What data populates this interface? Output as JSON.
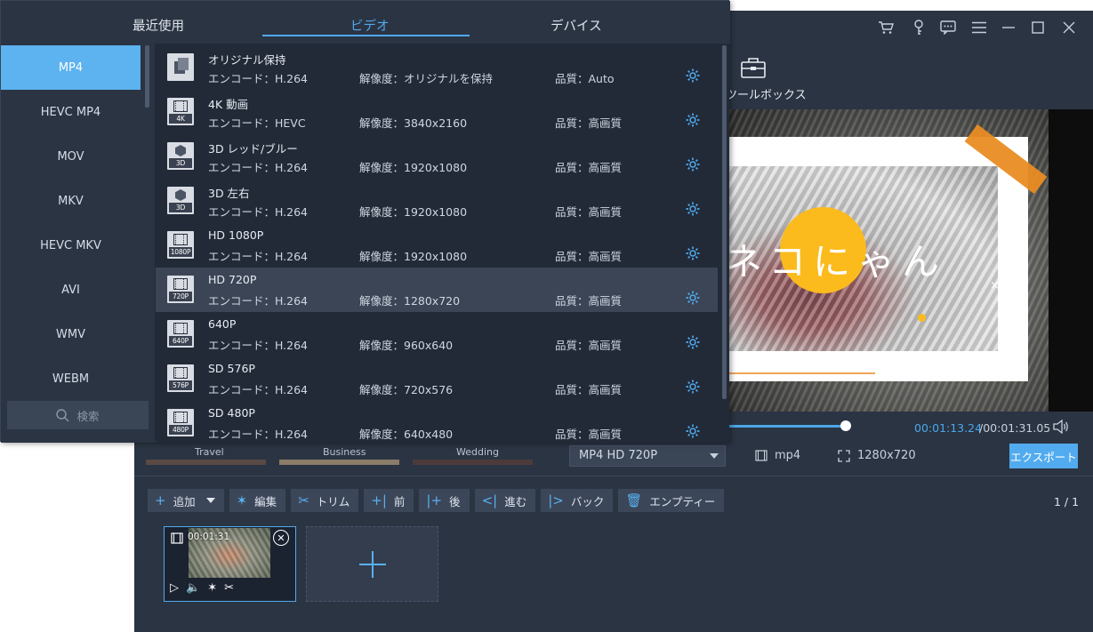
{
  "window": {
    "icons": [
      "cart-icon",
      "key-icon",
      "chat-icon",
      "menu-icon",
      "minimize-icon",
      "maximize-icon",
      "close-icon"
    ]
  },
  "toolbox": {
    "label": "ツールボックス"
  },
  "preview": {
    "title_text": "ネコにゃん"
  },
  "playback": {
    "current_time": "00:01:13.24",
    "total_time": "/00:01:31.05",
    "progress": 0.74
  },
  "themes": {
    "labels": [
      "Travel",
      "Business",
      "Wedding"
    ]
  },
  "output": {
    "format": "MP4 HD 720P",
    "extension": "mp4",
    "resolution": "1280x720",
    "export_label": "エクスポート"
  },
  "actions": [
    {
      "id": "add",
      "icon": "+",
      "label": "追加",
      "dropdown": true
    },
    {
      "id": "edit",
      "icon": "✶",
      "label": "編集"
    },
    {
      "id": "trim",
      "icon": "✂",
      "label": "トリム"
    },
    {
      "id": "before",
      "icon": "+|",
      "label": "前"
    },
    {
      "id": "after",
      "icon": "|+",
      "label": "後"
    },
    {
      "id": "forward",
      "icon": "<|",
      "label": "進む"
    },
    {
      "id": "back",
      "icon": "|>",
      "label": "バック"
    },
    {
      "id": "empty",
      "icon": "🗑",
      "label": "エンプティー"
    }
  ],
  "page_count": "1 / 1",
  "clip": {
    "duration": "00:01:31"
  },
  "format_panel": {
    "tabs": [
      {
        "label": "最近使用",
        "active": false
      },
      {
        "label": "ビデオ",
        "active": true
      },
      {
        "label": "デバイス",
        "active": false
      }
    ],
    "categories": [
      {
        "label": "MP4",
        "active": true
      },
      {
        "label": "HEVC MP4",
        "active": false
      },
      {
        "label": "MOV",
        "active": false
      },
      {
        "label": "MKV",
        "active": false
      },
      {
        "label": "HEVC MKV",
        "active": false
      },
      {
        "label": "AVI",
        "active": false
      },
      {
        "label": "WMV",
        "active": false
      },
      {
        "label": "WEBM",
        "active": false
      }
    ],
    "search_placeholder": "検索",
    "presets": [
      {
        "name": "オリジナル保持",
        "encode": "エンコード：H.264",
        "resolution": "解像度：オリジナルを保持",
        "quality": "品質：Auto",
        "icon": "original",
        "tag": "",
        "active": false
      },
      {
        "name": "4K 動画",
        "encode": "エンコード：HEVC",
        "resolution": "解像度：3840x2160",
        "quality": "品質：高画質",
        "icon": "film",
        "tag": "4K",
        "active": false
      },
      {
        "name": "3D レッド/ブルー",
        "encode": "エンコード：H.264",
        "resolution": "解像度：1920x1080",
        "quality": "品質：高画質",
        "icon": "cube",
        "tag": "3D",
        "active": false
      },
      {
        "name": "3D 左右",
        "encode": "エンコード：H.264",
        "resolution": "解像度：1920x1080",
        "quality": "品質：高画質",
        "icon": "cube",
        "tag": "3D",
        "active": false
      },
      {
        "name": "HD 1080P",
        "encode": "エンコード：H.264",
        "resolution": "解像度：1920x1080",
        "quality": "品質：高画質",
        "icon": "film",
        "tag": "1080P",
        "active": false
      },
      {
        "name": "HD 720P",
        "encode": "エンコード：H.264",
        "resolution": "解像度：1280x720",
        "quality": "品質：高画質",
        "icon": "film",
        "tag": "720P",
        "active": true
      },
      {
        "name": "640P",
        "encode": "エンコード：H.264",
        "resolution": "解像度：960x640",
        "quality": "品質：高画質",
        "icon": "film",
        "tag": "640P",
        "active": false
      },
      {
        "name": "SD 576P",
        "encode": "エンコード：H.264",
        "resolution": "解像度：720x576",
        "quality": "品質：高画質",
        "icon": "film",
        "tag": "576P",
        "active": false
      },
      {
        "name": "SD 480P",
        "encode": "エンコード：H.264",
        "resolution": "解像度：640x480",
        "quality": "品質：高画質",
        "icon": "film",
        "tag": "480P",
        "active": false
      }
    ]
  },
  "colors": {
    "accent": "#51aaee",
    "panel": "#222a38",
    "sidebar": "#2b3443",
    "active_category": "#5db2f0"
  }
}
